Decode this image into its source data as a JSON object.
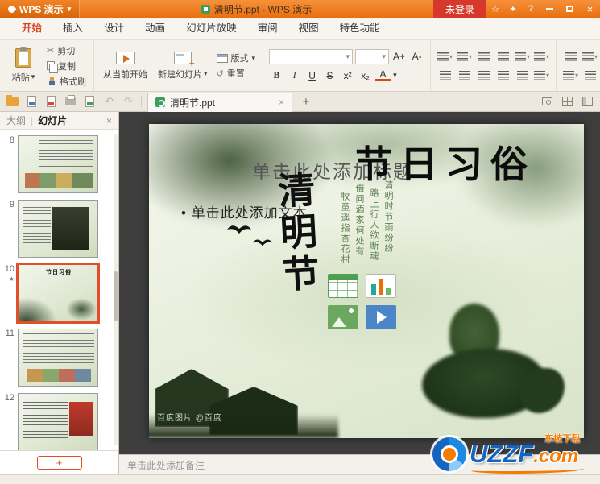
{
  "titlebar": {
    "app_logo": "WPS 演示",
    "document_title": "清明节.ppt - WPS 演示",
    "login_label": "未登录"
  },
  "icons": {
    "caret": "▾",
    "close": "×",
    "star": "★",
    "star_outline": "☆",
    "skin": "✦",
    "help": "?",
    "scissors": "✂",
    "undo": "↶",
    "redo": "↷",
    "plus": "+",
    "reset": "↺",
    "divider": "|"
  },
  "menu_tabs": [
    {
      "label": "开始",
      "active": true
    },
    {
      "label": "插入"
    },
    {
      "label": "设计"
    },
    {
      "label": "动画"
    },
    {
      "label": "幻灯片放映"
    },
    {
      "label": "审阅"
    },
    {
      "label": "视图"
    },
    {
      "label": "特色功能"
    }
  ],
  "ribbon": {
    "paste": "粘贴",
    "cut": "剪切",
    "copy": "复制",
    "format_painter": "格式刷",
    "start_from_current": "从当前开始",
    "new_slide": "新建幻灯片",
    "layout": "版式",
    "reset": "重置",
    "font_controls": {
      "bold": "B",
      "italic": "I",
      "underline": "U",
      "strike": "S",
      "superscript": "x²",
      "subscript": "x₂",
      "font_color": "A",
      "grow": "A+",
      "shrink": "A-"
    }
  },
  "doc_tab": {
    "label": "清明节.ppt"
  },
  "sidebar": {
    "outline_tab": "大纲",
    "slides_tab": "幻灯片",
    "slides": [
      {
        "number": "8"
      },
      {
        "number": "9"
      },
      {
        "number": "10",
        "selected": true,
        "starred": true,
        "title": "节日习俗"
      },
      {
        "number": "11"
      },
      {
        "number": "12"
      }
    ],
    "add_button": "+"
  },
  "slide": {
    "title_placeholder": "单击此处添加标题",
    "title": "节日习俗",
    "bullet_marker": "•",
    "body_placeholder": "单击此处添加文本",
    "vertical_title": "清明节",
    "poem": [
      "清明时节雨纷纷",
      "路上行人欲断魂",
      "借问酒家何处有",
      "牧童遥指杏花村"
    ],
    "watermark": "百度图片 @百度"
  },
  "notes_placeholder": "单击此处添加备注",
  "watermark_logo": {
    "brand": "UZZF",
    "domain": ".com",
    "site_name": "东坡下载"
  },
  "colors": {
    "titlebar_orange": "#ee7212",
    "accent_orange": "#d9451f",
    "login_red": "#d6392c",
    "canvas_gray": "#3e3e3e",
    "selection_red": "#e0502a",
    "slide_green": "#6b8f5a",
    "uzzf_blue": "#1565c0",
    "uzzf_orange": "#f57c00"
  }
}
